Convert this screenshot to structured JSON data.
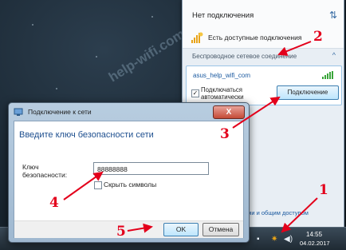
{
  "watermark": "help-wifi.com",
  "flyout": {
    "title": "Нет подключения",
    "available": "Есть доступные подключения",
    "section": "Беспроводное сетевое соединение",
    "network_name": "asus_help_wifi_com",
    "auto_connect": "Подключаться автоматически",
    "connect_button": "Подключение",
    "footer_link": "сетями и общим доступом"
  },
  "dialog": {
    "title": "Подключение к сети",
    "heading": "Введите ключ безопасности сети",
    "key_label": "Ключ безопасности:",
    "key_value": "88888888",
    "hide_chars": "Скрыть символы",
    "ok": "OK",
    "cancel": "Отмена",
    "close": "X"
  },
  "taskbar": {
    "time": "14:55",
    "date": "04.02.2017"
  },
  "annotations": [
    "1",
    "2",
    "3",
    "4",
    "5"
  ],
  "colors": {
    "annotation": "#e3001b",
    "accent": "#3c7fb1"
  }
}
